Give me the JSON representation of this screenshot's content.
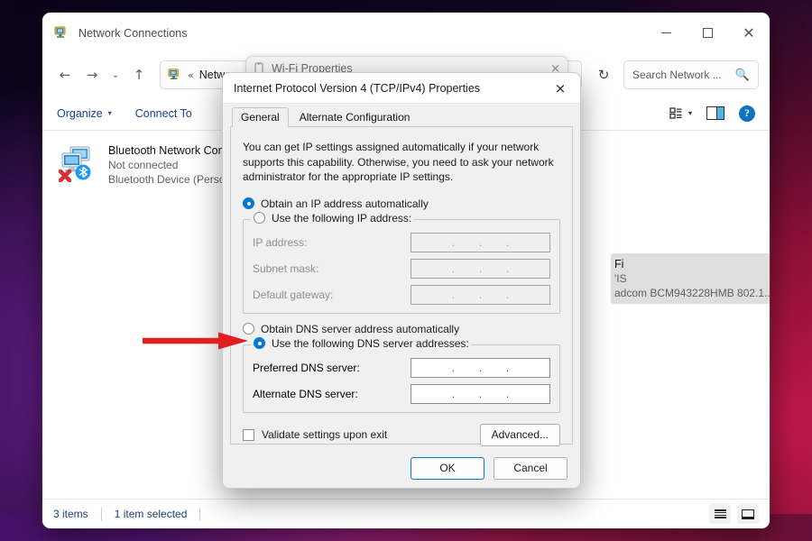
{
  "explorer": {
    "title": "Network Connections",
    "title_icon": "network-connections-icon",
    "window_controls": {
      "minimize": "minimize-icon",
      "maximize": "maximize-icon",
      "close": "close-icon"
    },
    "nav": {
      "back": "back-arrow-icon",
      "forward": "forward-arrow-icon",
      "recent": "chevron-down-icon",
      "up": "up-arrow-icon",
      "address_chevron": "«",
      "address_text": "Netwo",
      "refresh": "refresh-icon"
    },
    "search": {
      "placeholder": "Search Network ...",
      "icon": "search-icon"
    },
    "commandbar": {
      "organize": "Organize",
      "organize_caret": "▾",
      "connect_to": "Connect To",
      "view_icon": "view-options-icon",
      "view_caret": "▾",
      "preview_pane_icon": "preview-pane-icon",
      "help_icon": "help-icon",
      "help_glyph": "?"
    },
    "items": [
      {
        "name": "Bluetooth Network Conr",
        "status": "Not connected",
        "device": "Bluetooth Device (Persor",
        "icon": "network-adapter-icon",
        "selected": false
      },
      {
        "name": "Fi",
        "status": "'IS",
        "device": "adcom BCM943228HMB 802.1...",
        "icon": "wifi-adapter-icon",
        "selected": true
      }
    ],
    "statusbar": {
      "item_count": "3 items",
      "selection": "1 item selected",
      "details_view_icon": "details-view-icon",
      "tiles_view_icon": "large-icons-view-icon"
    }
  },
  "wifi_properties": {
    "title": "Wi-Fi Properties",
    "icon": "properties-icon",
    "close": "×"
  },
  "ipv4_dialog": {
    "title": "Internet Protocol Version 4 (TCP/IPv4) Properties",
    "close_glyph": "×",
    "tabs": [
      {
        "label": "General",
        "active": true
      },
      {
        "label": "Alternate Configuration",
        "active": false
      }
    ],
    "description": "You can get IP settings assigned automatically if your network supports this capability. Otherwise, you need to ask your network administrator for the appropriate IP settings.",
    "ip_section": {
      "auto_option": "Obtain an IP address automatically",
      "auto_selected": true,
      "manual_option": "Use the following IP address:",
      "manual_selected": false,
      "fields": [
        {
          "label": "IP address:",
          "value": "",
          "disabled": true
        },
        {
          "label": "Subnet mask:",
          "value": "",
          "disabled": true
        },
        {
          "label": "Default gateway:",
          "value": "",
          "disabled": true
        }
      ]
    },
    "dns_section": {
      "auto_option": "Obtain DNS server address automatically",
      "auto_selected": false,
      "manual_option": "Use the following DNS server addresses:",
      "manual_selected": true,
      "fields": [
        {
          "label": "Preferred DNS server:",
          "value": "",
          "disabled": false
        },
        {
          "label": "Alternate DNS server:",
          "value": "",
          "disabled": false
        }
      ]
    },
    "validate_checkbox": {
      "label": "Validate settings upon exit",
      "checked": false
    },
    "advanced_button": "Advanced...",
    "ok_button": "OK",
    "cancel_button": "Cancel",
    "dot_separator": "."
  },
  "annotation": {
    "arrow_color": "#e02020",
    "points_to": "Use the following DNS server addresses: radio button"
  }
}
